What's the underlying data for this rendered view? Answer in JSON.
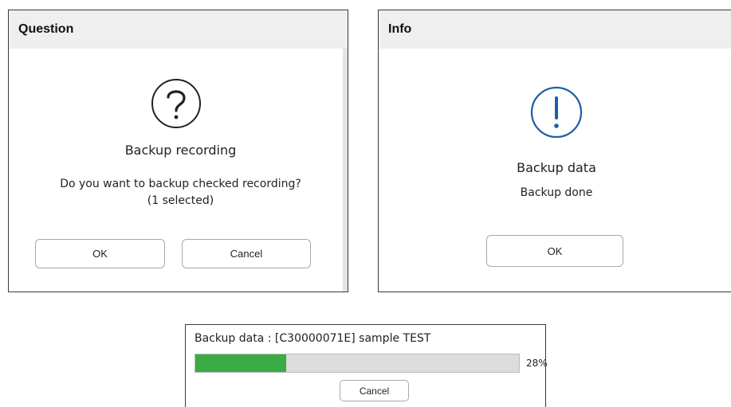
{
  "question_dialog": {
    "title": "Question",
    "icon": "question-circle-icon",
    "heading": "Backup recording",
    "message_line1": "Do you want to backup checked recording?",
    "message_line2": "(1 selected)",
    "ok_label": "OK",
    "cancel_label": "Cancel"
  },
  "info_dialog": {
    "title": "Info",
    "icon": "exclamation-circle-icon",
    "icon_color": "#1e5fa8",
    "heading": "Backup data",
    "message": "Backup done",
    "ok_label": "OK"
  },
  "progress_dialog": {
    "label": "Backup data : [C30000071E] sample TEST",
    "progress_percent": 28,
    "progress_text": "28%",
    "bar_color": "#3bab45",
    "cancel_label": "Cancel"
  }
}
